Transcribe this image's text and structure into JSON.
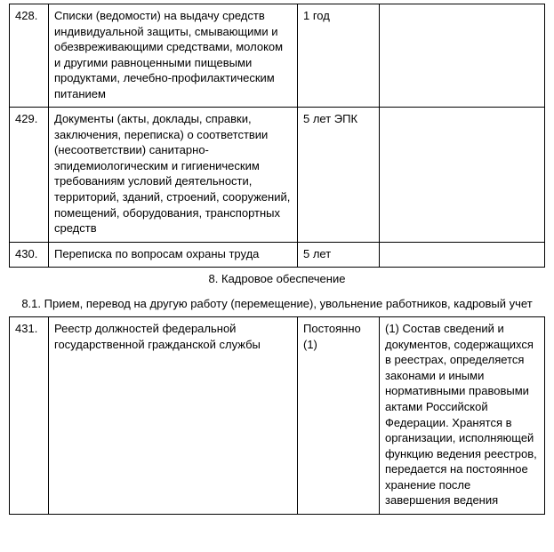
{
  "rows": [
    {
      "num": "428.",
      "desc": "Списки (ведомости) на выдачу средств индивидуальной защиты, смывающими и обезвреживающими средствами, молоком и другими равноценными пищевыми продуктами, лечебно-профилактическим питанием",
      "term": "1 год",
      "note": ""
    },
    {
      "num": "429.",
      "desc": "Документы (акты, доклады, справки, заключения, переписка) о соответствии (несоответствии) санитарно-эпидемиологическим и гигиеническим требованиям условий деятельности, территорий, зданий, строений, сооружений, помещений, оборудования, транспортных средств",
      "term": "5 лет ЭПК",
      "note": ""
    },
    {
      "num": "430.",
      "desc": "Переписка по вопросам охраны труда",
      "term": "5 лет",
      "note": ""
    }
  ],
  "section": "8. Кадровое обеспечение",
  "subsection": "8.1. Прием, перевод на другую работу (перемещение), увольнение работников, кадровый учет",
  "rows2": [
    {
      "num": "431.",
      "desc": "Реестр должностей федеральной государственной гражданской службы",
      "term": "Постоянно (1)",
      "note": "(1) Состав сведений и документов, содержащихся в реестрах, определяется законами и иными нормативными правовыми актами Российской Федерации. Хранятся в организации, исполняющей функцию ведения реестров, передается на постоянное хранение после завершения ведения"
    }
  ]
}
